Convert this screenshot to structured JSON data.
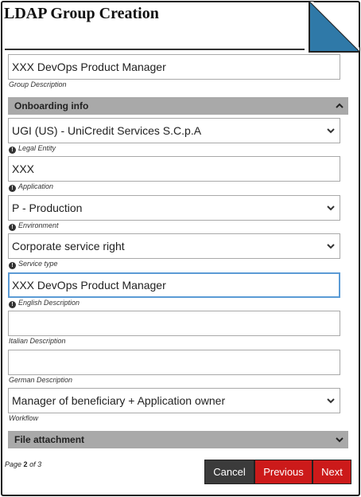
{
  "header": {
    "title": "LDAP Group Creation"
  },
  "group_description": {
    "value": "XXX DevOps Product Manager",
    "label": "Group Description"
  },
  "sections": {
    "onboarding": "Onboarding info",
    "file_attachment": "File attachment"
  },
  "legal_entity": {
    "value": "UGI (US) - UniCredit Services S.C.p.A",
    "label": "Legal Entity"
  },
  "application": {
    "value": "XXX",
    "label": "Application"
  },
  "environment": {
    "value": "P - Production",
    "label": "Environment"
  },
  "service_type": {
    "value": "Corporate service right",
    "label": "Service type"
  },
  "english_description": {
    "value": "XXX DevOps Product Manager",
    "label": "English Description"
  },
  "italian_description": {
    "value": "",
    "label": "Italian Description"
  },
  "german_description": {
    "value": "",
    "label": "German Description"
  },
  "workflow": {
    "value": "Manager of beneficiary + Application owner",
    "label": "Workflow"
  },
  "pager": {
    "prefix": "Page",
    "current": "2",
    "middle": "of",
    "total": "3"
  },
  "buttons": {
    "cancel": "Cancel",
    "previous": "Previous",
    "next": "Next"
  },
  "colors": {
    "accent_red": "#cc1a1a",
    "cancel_gray": "#3b3b3b",
    "section_gray": "#a9a9a9",
    "corner_blue": "#2f79a8",
    "focus_blue": "#5b9bd5"
  }
}
